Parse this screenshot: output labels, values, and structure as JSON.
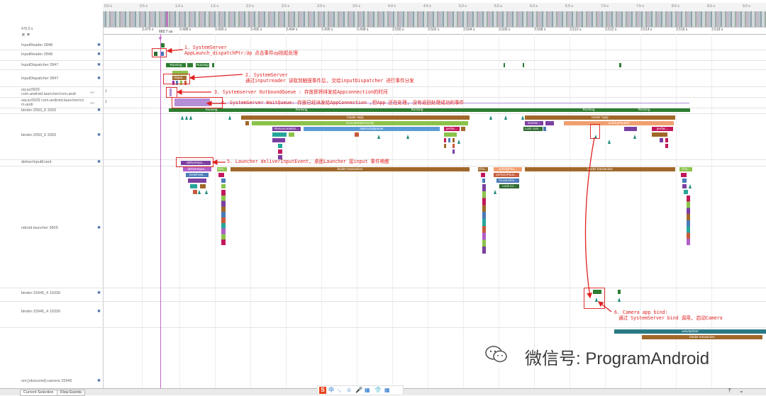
{
  "overview": {
    "ticks": [
      "0.0 s",
      "0.5 s",
      "1.0 s",
      "1.5 s",
      "2.0 s",
      "2.5 s",
      "3.0 s",
      "3.5 s",
      "4.0 s",
      "4.5 s",
      "5.0 s",
      "5.5 s",
      "6.0 s",
      "6.5 s",
      "7.0 s",
      "7.5 s",
      "8.0 s",
      "8.5 s",
      "9.0 s"
    ]
  },
  "ruler": {
    "left_label": "476.5 s",
    "ticks": [
      "3.476 s",
      "3.488 s",
      "3.490 s",
      "3.492 s",
      "3.494 s",
      "3.496 s",
      "3.498 s",
      "3.500 s",
      "3.502 s",
      "3.504 s",
      "3.506 s",
      "3.508 s",
      "3.510 s",
      "3.512 s",
      "3.514 s",
      "3.516 s",
      "3.518 s"
    ],
    "cursor_label": "683.7 us"
  },
  "tracks": [
    {
      "name": "InputReader 2848"
    },
    {
      "name": "InputReader 2848"
    },
    {
      "name": "InputDispatcher 2847"
    },
    {
      "name": "InputDispatcher 2847"
    },
    {
      "name": "oq:ac0929 com.android.launcher/com.andr"
    },
    {
      "name": "wq:ac0929 com.android.launcher/co m.andr"
    },
    {
      "name": "binder:2093_6 3303"
    },
    {
      "name": "binder:2093_6 3303"
    },
    {
      "name": "deliverInputEvent"
    },
    {
      "name": "ndroid.launcher 3659"
    },
    {
      "name": "binder:15945_4 16330"
    },
    {
      "name": "binder:15945_4 16330"
    },
    {
      "name": "om.[obscured].camera 15945"
    }
  ],
  "slices": {
    "running": "Running",
    "binder_reply": "binder reply",
    "execute_start": "executeStartActivity",
    "start_activity_inner": "startActivityInner",
    "resource_mgr": "ResourcesMan...",
    "perfac": "perfac...",
    "dispat": "dispat...",
    "deliver_input": "deliverInpu...",
    "deliver_input2": "deliverInput...",
    "view_posti": "ViewPosti...",
    "binder_transaction": "binder transaction",
    "activity_paused": "activityPaused",
    "activity_pau": "activityPau...",
    "perform_paus": "performPaus...",
    "oi_launcher": "OLauncher...",
    "lock_co": "Lock co...",
    "lock_com": "Lock com...",
    "monitor": "monitor...",
    "activity_start": "activityStart",
    "cho": "Cho..."
  },
  "annotations": {
    "a1_line1": "1. SystemServer",
    "a1_line2": "AppLaunch_dispatchPtr:Up 点击事件up抬起处理",
    "a2_line1": "2. SystemServer",
    "a2_line2": "通过inputreader 读取到触摸事件后, 交给inputDispatcher 进行事件分发",
    "a3": "3. Systemserver OutboundQueue : 存放即将排发给Appconnection的时间",
    "a4": "4. SystemServer WaitQueue:  存放已经派发给AppConnection ,但App 还在处理, 没有返回处理成功的事件",
    "a5": "5. Launcher deliverInputEvent,  桌面Launcher 接input 事件唤醒",
    "a6_line1": "6. Camera app bind:",
    "a6_line2": "通过 SystemServer bind 调用, 启动Camera"
  },
  "watermark": {
    "text": "微信号: ProgramAndroid"
  },
  "bottom": {
    "tabs": [
      "Current Selection",
      "Flow Events"
    ]
  },
  "ime": {
    "icons": [
      "S",
      "中",
      "·,",
      "☺",
      "🎤",
      "▦",
      "👕",
      "▦"
    ]
  },
  "colors": {
    "annotation": "#e02020",
    "running": "#2e7d32",
    "binder": "#a0682a",
    "purple": "#8e44ad",
    "cursor": "#c766c7"
  }
}
